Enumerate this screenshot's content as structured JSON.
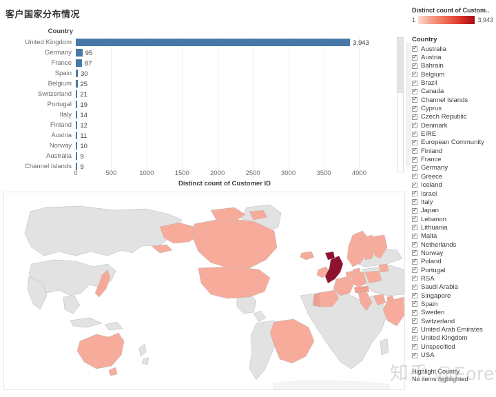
{
  "header": {
    "title": "客户国家分布情况"
  },
  "bar_chart": {
    "column_header": "Country",
    "axis_title": "Distinct count of Customer ID",
    "ticks": [
      "0",
      "500",
      "1000",
      "1500",
      "2000",
      "2500",
      "3000",
      "3500",
      "4000"
    ],
    "bar_color": "#4878a8"
  },
  "legend": {
    "title": "Distinct count of Custom..",
    "min": "1",
    "max": "3,943",
    "color_low": "#fbdcd3",
    "color_high": "#a40d19"
  },
  "filter": {
    "title": "Country",
    "items": [
      "Australia",
      "Austria",
      "Bahrain",
      "Belgium",
      "Brazil",
      "Canada",
      "Channel Islands",
      "Cyprus",
      "Czech Republic",
      "Denmark",
      "EIRE",
      "European Community",
      "Finland",
      "France",
      "Germany",
      "Greece",
      "Iceland",
      "Israel",
      "Italy",
      "Japan",
      "Lebanon",
      "Lithuania",
      "Malta",
      "Netherlands",
      "Norway",
      "Poland",
      "Portugal",
      "RSA",
      "Saudi Arabia",
      "Singapore",
      "Spain",
      "Sweden",
      "Switzerland",
      "United Arab Emirates",
      "United Kingdom",
      "Unspecified",
      "USA"
    ]
  },
  "highlighter": {
    "title": "Highlight Country",
    "status": "No items highlighted"
  },
  "watermark": {
    "text": "知乎 @Foreverme"
  },
  "chart_data": {
    "type": "bar",
    "orientation": "horizontal",
    "title": "客户国家分布情况",
    "xlabel": "Distinct count of Customer ID",
    "ylabel": "Country",
    "xlim": [
      0,
      4200
    ],
    "grid": true,
    "categories": [
      "United Kingdom",
      "Germany",
      "France",
      "Spain",
      "Belgium",
      "Switzerland",
      "Portugal",
      "Italy",
      "Finland",
      "Austria",
      "Norway",
      "Australia",
      "Channel Islands"
    ],
    "values": [
      3943,
      95,
      87,
      30,
      25,
      21,
      19,
      14,
      12,
      11,
      10,
      9,
      9
    ],
    "value_labels": [
      "3,943",
      "95",
      "87",
      "30",
      "25",
      "21",
      "19",
      "14",
      "12",
      "11",
      "10",
      "9",
      "9"
    ]
  },
  "map": {
    "type": "choropleth",
    "measure": "Distinct count of Customer ID",
    "scale_min": 1,
    "scale_max": 3943,
    "highlighted_country": "United Kingdom",
    "no_data_color": "#e2e2e2",
    "ocean_color": "#ffffff"
  }
}
